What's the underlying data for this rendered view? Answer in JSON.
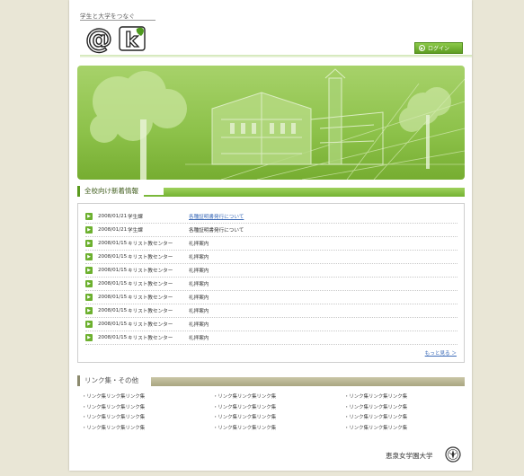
{
  "header": {
    "tagline": "学生と大学をつなぐ",
    "logo_text": "@k",
    "login_label": "ログイン"
  },
  "news": {
    "section_title": "全校向け新着情報",
    "items": [
      {
        "date": "2008/01/21",
        "dept": "学生課",
        "title": "各種証明書発行について",
        "link": true
      },
      {
        "date": "2008/01/21",
        "dept": "学生課",
        "title": "各種証明書発行について",
        "link": false
      },
      {
        "date": "2008/01/15",
        "dept": "キリスト教センター",
        "title": "礼拝案内",
        "link": false
      },
      {
        "date": "2008/01/15",
        "dept": "キリスト教センター",
        "title": "礼拝案内",
        "link": false
      },
      {
        "date": "2008/01/15",
        "dept": "キリスト教センター",
        "title": "礼拝案内",
        "link": false
      },
      {
        "date": "2008/01/15",
        "dept": "キリスト教センター",
        "title": "礼拝案内",
        "link": false
      },
      {
        "date": "2008/01/15",
        "dept": "キリスト教センター",
        "title": "礼拝案内",
        "link": false
      },
      {
        "date": "2008/01/15",
        "dept": "キリスト教センター",
        "title": "礼拝案内",
        "link": false
      },
      {
        "date": "2008/01/15",
        "dept": "キリスト教センター",
        "title": "礼拝案内",
        "link": false
      },
      {
        "date": "2008/01/15",
        "dept": "キリスト教センター",
        "title": "礼拝案内",
        "link": false
      }
    ],
    "more_label": "もっと見る ＞"
  },
  "links": {
    "section_title": "リンク集・その他",
    "items": [
      "・リンク集リンク集リンク集",
      "・リンク集リンク集リンク集",
      "・リンク集リンク集リンク集",
      "・リンク集リンク集リンク集",
      "・リンク集リンク集リンク集",
      "・リンク集リンク集リンク集",
      "・リンク集リンク集リンク集",
      "・リンク集リンク集リンク集",
      "・リンク集リンク集リンク集",
      "・リンク集リンク集リンク集",
      "・リンク集リンク集リンク集",
      "・リンク集リンク集リンク集"
    ]
  },
  "footer": {
    "university_name": "恵泉女学園大学"
  },
  "colors": {
    "accent_green": "#7ab83a",
    "hero_green": "#8cc149",
    "link_blue": "#3b6ab8",
    "background": "#e9e6d6"
  }
}
